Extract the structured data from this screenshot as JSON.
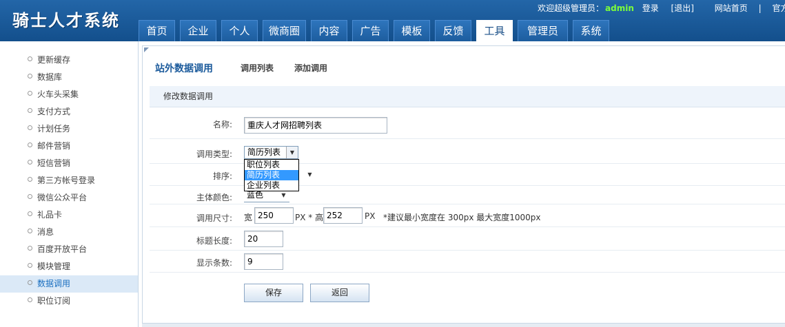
{
  "app": {
    "logo": "骑士人才系统"
  },
  "topbar": {
    "welcome": "欢迎超级管理员：",
    "user": "admin",
    "login": "登录",
    "logout": "[退出]",
    "site_home": "网站首页",
    "sep": "|",
    "forum": "官方论坛"
  },
  "nav": {
    "tabs": [
      "首页",
      "企业",
      "个人",
      "微商圈",
      "内容",
      "广告",
      "模板",
      "反馈",
      "工具",
      "管理员",
      "系统"
    ],
    "active": "工具"
  },
  "sidebar": {
    "items": [
      "更新缓存",
      "数据库",
      "火车头采集",
      "支付方式",
      "计划任务",
      "邮件营销",
      "短信营销",
      "第三方帐号登录",
      "微信公众平台",
      "礼品卡",
      "消息",
      "百度开放平台",
      "模块管理",
      "数据调用",
      "职位订阅"
    ],
    "active": "数据调用"
  },
  "page": {
    "title": "站外数据调用",
    "tab_list": "调用列表",
    "tab_add": "添加调用",
    "section": "修改数据调用"
  },
  "form": {
    "name_label": "名称:",
    "name_value": "重庆人才网招聘列表",
    "type_label": "调用类型:",
    "type_value": "简历列表",
    "type_options": [
      "职位列表",
      "简历列表",
      "企业列表"
    ],
    "sort_label": "排序:",
    "color_label": "主体颜色:",
    "color_value": "蓝色",
    "size_label": "调用尺寸:",
    "width_prefix": "宽",
    "width_value": "250",
    "px_high": "PX * 高",
    "height_value": "252",
    "px_unit": "PX",
    "size_hint": "*建议最小宽度在 300px 最大宽度1000px",
    "title_len_label": "标题长度:",
    "title_len_value": "20",
    "count_label": "显示条数:",
    "count_value": "9",
    "save": "保存",
    "back": "返回"
  }
}
